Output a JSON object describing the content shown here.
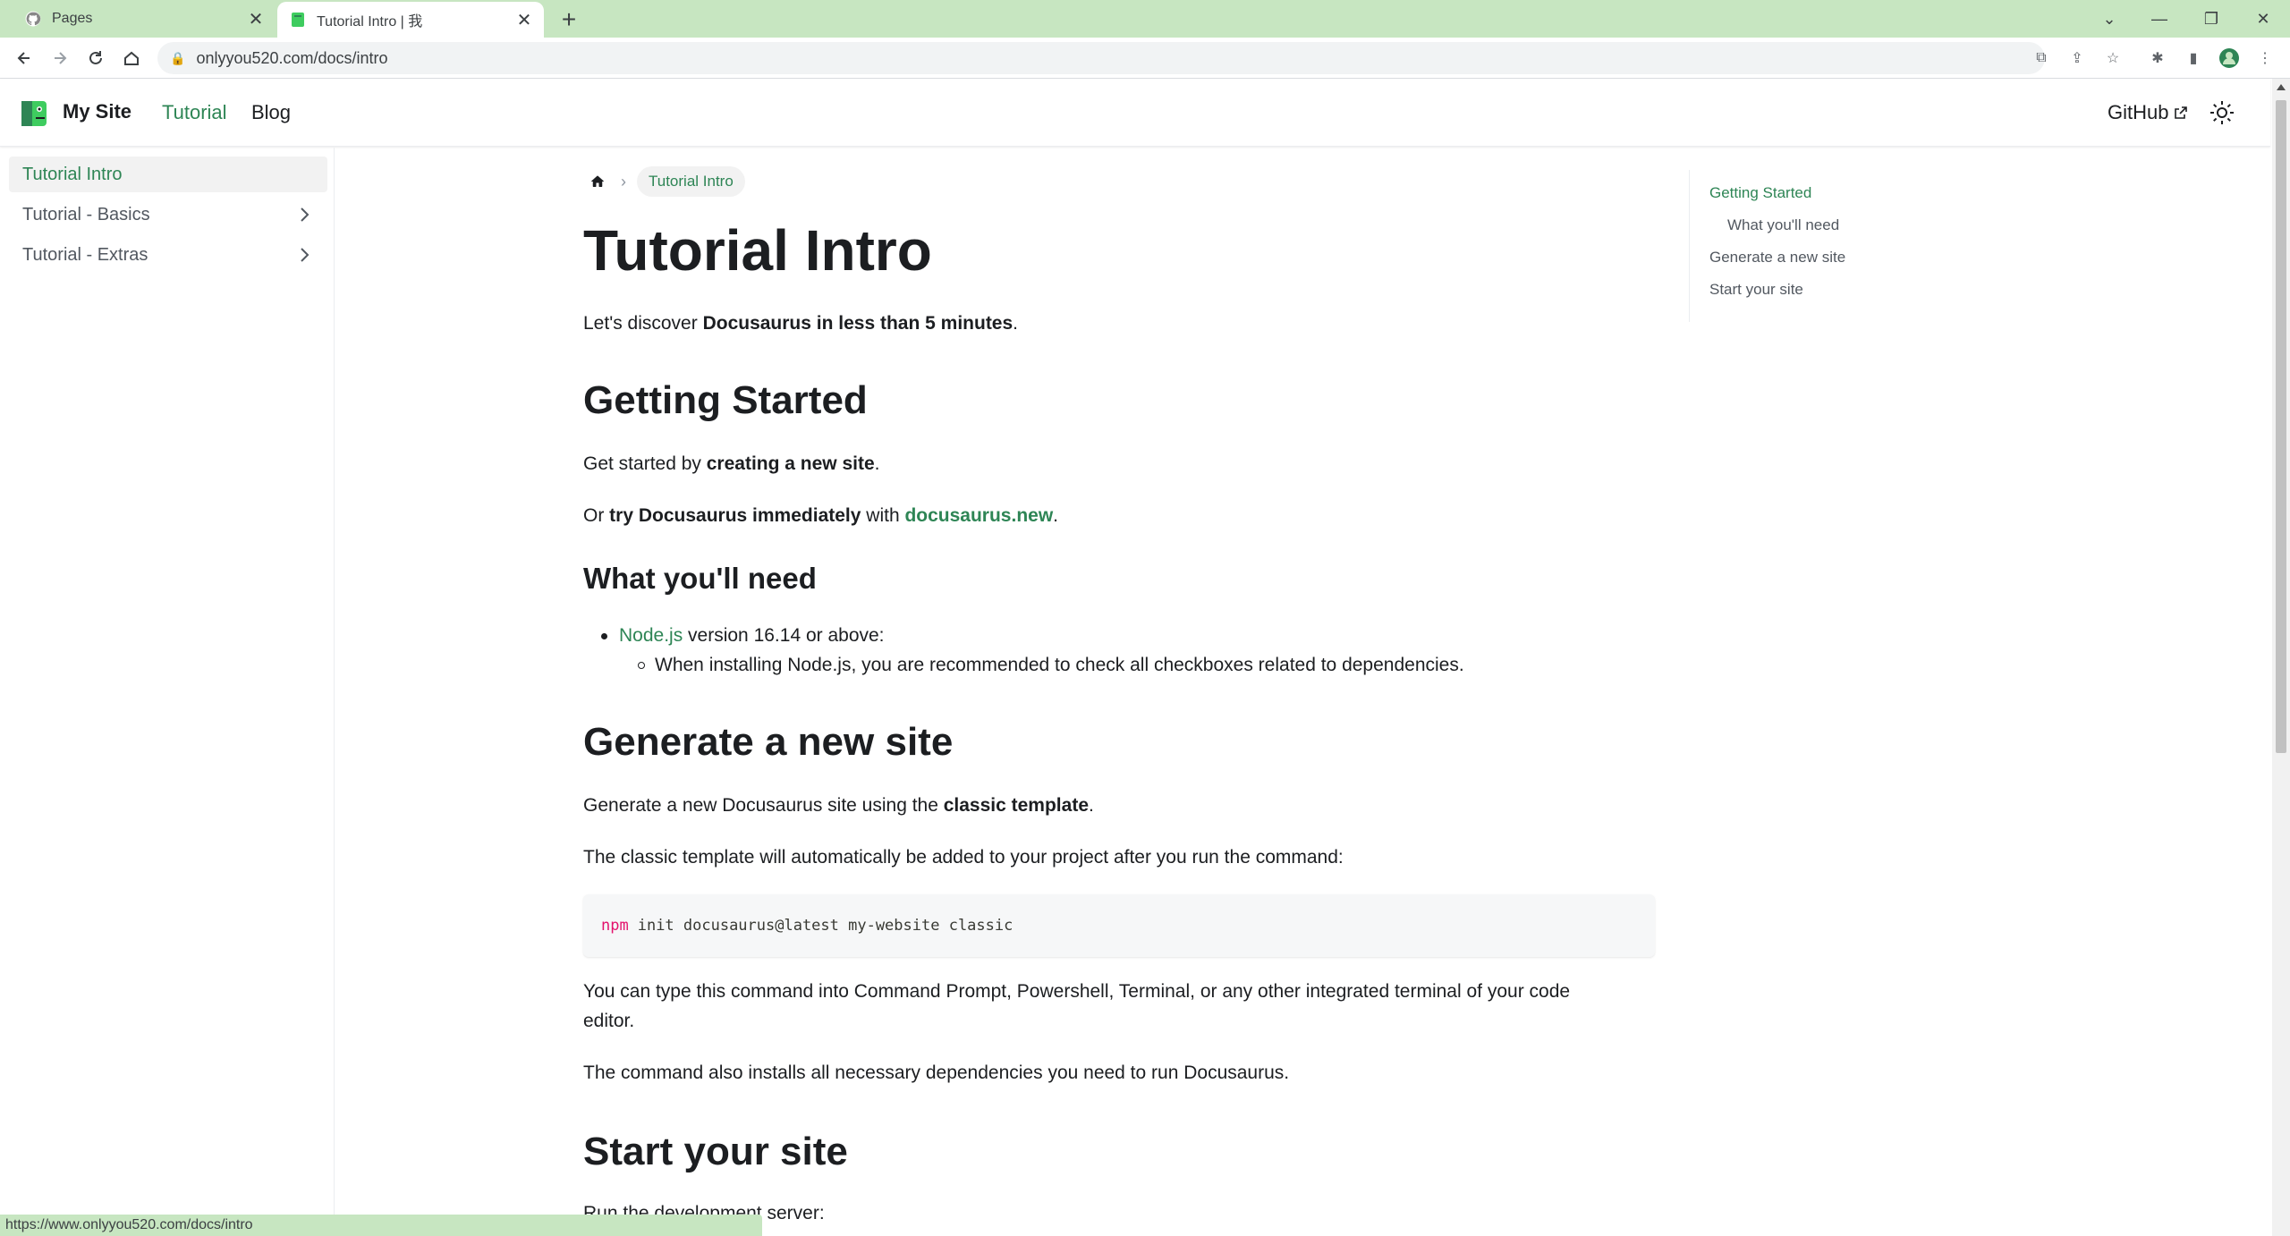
{
  "browser": {
    "tabs": [
      {
        "title": "Pages",
        "active": false
      },
      {
        "title": "Tutorial Intro | 我",
        "active": true
      }
    ],
    "new_tab_label": "+",
    "url_display": "onlyyou520.com/docs/intro",
    "status_url": "https://www.onlyyou520.com/docs/intro"
  },
  "navbar": {
    "brand": "My Site",
    "links": [
      "Tutorial",
      "Blog"
    ],
    "active_link": "Tutorial",
    "github": "GitHub"
  },
  "sidebar": {
    "items": [
      {
        "label": "Tutorial Intro",
        "active": true,
        "expandable": false
      },
      {
        "label": "Tutorial - Basics",
        "active": false,
        "expandable": true
      },
      {
        "label": "Tutorial - Extras",
        "active": false,
        "expandable": true
      }
    ]
  },
  "doc": {
    "breadcrumb_current": "Tutorial Intro",
    "title": "Tutorial Intro",
    "intro": {
      "pre": "Let's discover ",
      "bold": "Docusaurus in less than 5 minutes",
      "post": "."
    },
    "getting_started": {
      "heading": "Getting Started",
      "p1": {
        "pre": "Get started by ",
        "bold": "creating a new site",
        "post": "."
      },
      "p2": {
        "pre": "Or ",
        "bold": "try Docusaurus immediately",
        "mid": " with ",
        "link": "docusaurus.new",
        "post": "."
      }
    },
    "what_you_need": {
      "heading": "What you'll need",
      "item_link": "Node.js",
      "item_text": " version 16.14 or above:",
      "subitem": "When installing Node.js, you are recommended to check all checkboxes related to dependencies."
    },
    "generate": {
      "heading": "Generate a new site",
      "p1": {
        "pre": "Generate a new Docusaurus site using the ",
        "bold": "classic template",
        "post": "."
      },
      "p2": "The classic template will automatically be added to your project after you run the command:",
      "code_cmd": "npm",
      "code_args": "init docusaurus@latest my-website classic",
      "p3_line1": "You can type this command into Command Prompt, Powershell, Terminal, or any other integrated terminal of your code",
      "p3_line2": "editor.",
      "p4": "The command also installs all necessary dependencies you need to run Docusaurus."
    },
    "start": {
      "heading": "Start your site",
      "p1": "Run the development server:"
    }
  },
  "toc": {
    "items": [
      {
        "label": "Getting Started",
        "level": 2,
        "active": true
      },
      {
        "label": "What you'll need",
        "level": 3,
        "active": false
      },
      {
        "label": "Generate a new site",
        "level": 2,
        "active": false
      },
      {
        "label": "Start your site",
        "level": 2,
        "active": false
      }
    ]
  },
  "colors": {
    "accent": "#2e8555",
    "chrome": "#c7e6c1",
    "code_keyword": "#e3116c"
  }
}
